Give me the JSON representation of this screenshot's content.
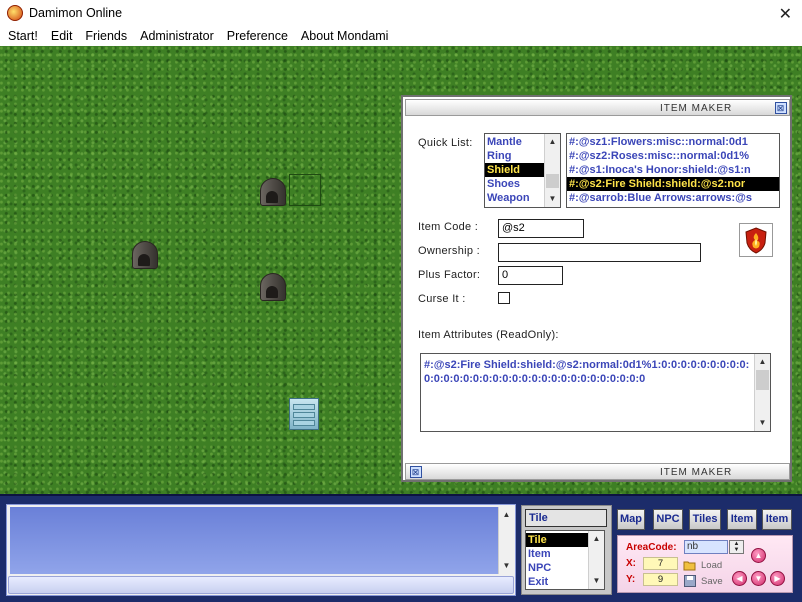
{
  "window": {
    "title": "Damimon Online",
    "close_glyph": "✕"
  },
  "menu": [
    "Start!",
    "Edit",
    "Friends",
    "Administrator",
    "Preference",
    "About Mondami"
  ],
  "item_maker": {
    "caption": "ITEM MAKER",
    "labels": {
      "quick_list": "Quick List:",
      "item_code": "Item Code  :",
      "ownership": "Ownership  :",
      "plus_factor": "Plus Factor:",
      "curse_it": "Curse It    :",
      "attributes": "Item Attributes (ReadOnly):"
    },
    "categories": [
      "Mantle",
      "Ring",
      "Shield",
      "Shoes",
      "Weapon"
    ],
    "selected_category": "Shield",
    "codes": [
      "#:@sz1:Flowers:misc::normal:0d1",
      "#:@sz2:Roses:misc::normal:0d1%",
      "#:@s1:Inoca's Honor:shield:@s1:n",
      "#:@s2:Fire Shield:shield:@s2:nor",
      "#:@sarrob:Blue Arrows:arrows:@s"
    ],
    "selected_code": "#:@s2:Fire Shield:shield:@s2:nor",
    "item_code_value": "@s2",
    "ownership_value": "",
    "plus_factor_value": "0",
    "curse_checked": false,
    "attributes_text": "#:@s2:Fire Shield:shield:@s2:normal:0d1%1:0:0:0:0:0:0:0:0:0:0:0:0:0:0:0:0:0:0:0:0:0:0:0:0:0:0:0:0:0:0:0:0"
  },
  "type_panel": {
    "combo_value": "Tile",
    "options": [
      "Tile",
      "Item",
      "NPC",
      "Exit"
    ],
    "selected": "Tile"
  },
  "nav_buttons": [
    "Map",
    "NPC",
    "Tiles",
    "Item",
    "Item"
  ],
  "controls": {
    "area_code_label": "AreaCode:",
    "area_code_value": "nb",
    "x_label": "X:",
    "x_value": "7",
    "y_label": "Y:",
    "y_value": "9",
    "load_label": "Load",
    "save_label": "Save"
  },
  "icons": {
    "app": "damimon-logo-icon",
    "graves": "tombstone-icon",
    "cabinet": "cabinet-icon",
    "shield": "fire-shield-icon",
    "arrows": [
      "arrow-up-icon",
      "arrow-left-icon",
      "arrow-down-icon",
      "arrow-right-icon"
    ]
  },
  "colors": {
    "grass": "#3e7f24",
    "list_text": "#3b46b8",
    "selection_bg": "#000000",
    "selection_text": "#ffe54a",
    "panel_bg": "#1c2c6a"
  }
}
